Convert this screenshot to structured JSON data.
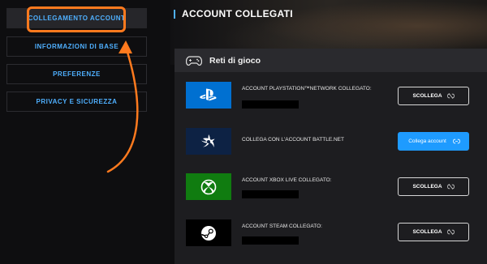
{
  "sidebar": {
    "items": [
      {
        "label": "COLLEGAMENTO ACCOUNT",
        "active": true
      },
      {
        "label": "INFORMAZIONI DI BASE",
        "active": false
      },
      {
        "label": "PREFERENZE",
        "active": false
      },
      {
        "label": "PRIVACY E SICUREZZA",
        "active": false
      }
    ]
  },
  "colors": {
    "accent": "#4fb0ff",
    "highlight": "#ff7a1e",
    "primary_button": "#1e9bff"
  },
  "main": {
    "title": "ACCOUNT COLLEGATI",
    "panel": {
      "icon": "gamepad-icon",
      "title": "Reti di gioco",
      "networks": [
        {
          "icon": "playstation-icon",
          "label": "ACCOUNT PLAYSTATION™NETWORK COLLEGATO:",
          "button": "SCOLLEGA",
          "button_icon": "unlink-icon"
        },
        {
          "icon": "battlenet-icon",
          "label": "COLLEGA CON L'ACCOUNT BATTLE.NET",
          "button": "Collega account",
          "button_icon": "link-icon"
        },
        {
          "icon": "xbox-icon",
          "label": "ACCOUNT XBOX LIVE COLLEGATO:",
          "button": "SCOLLEGA",
          "button_icon": "unlink-icon"
        },
        {
          "icon": "steam-icon",
          "label": "ACCOUNT STEAM COLLEGATO:",
          "button": "SCOLLEGA",
          "button_icon": "unlink-icon"
        }
      ]
    }
  }
}
